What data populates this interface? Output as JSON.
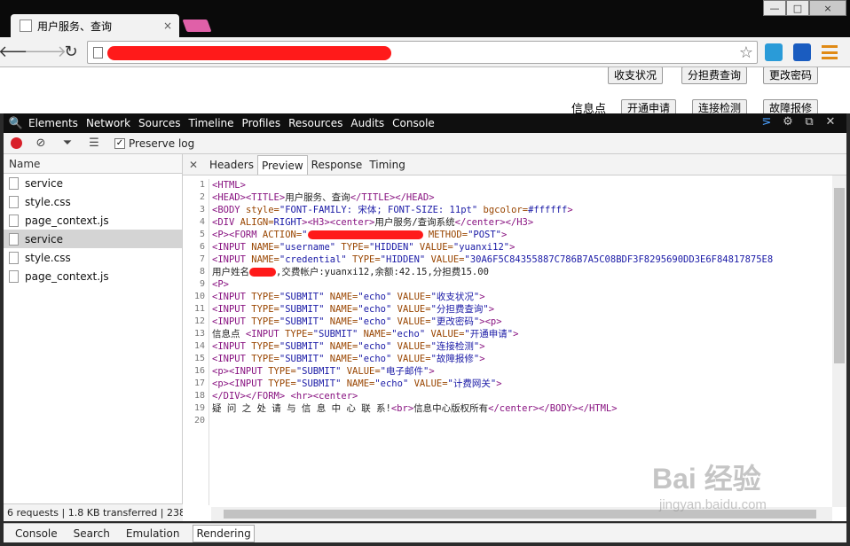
{
  "browser": {
    "tab_title": "用户服务、查询",
    "tab_close": "×",
    "win_min": "—",
    "win_max": "□",
    "win_close": "×"
  },
  "page": {
    "buttons": [
      "收支状况",
      "分担费查询",
      "更改密码",
      "开通申请",
      "连接检测",
      "故障报修"
    ],
    "info_label": "信息点"
  },
  "devtools": {
    "tabs": [
      "Elements",
      "Network",
      "Sources",
      "Timeline",
      "Profiles",
      "Resources",
      "Audits",
      "Console"
    ],
    "preserve_log": "Preserve log",
    "name_header": "Name",
    "requests": [
      {
        "name": "service",
        "selected": false
      },
      {
        "name": "style.css",
        "selected": false
      },
      {
        "name": "page_context.js",
        "selected": false
      },
      {
        "name": "service",
        "selected": true
      },
      {
        "name": "style.css",
        "selected": false
      },
      {
        "name": "page_context.js",
        "selected": false
      }
    ],
    "status_summary": "6 requests | 1.8 KB transferred | 238 ...",
    "subtabs": [
      "Headers",
      "Preview",
      "Response",
      "Timing"
    ],
    "active_subtab": "Preview",
    "drawer_tabs": [
      "Console",
      "Search",
      "Emulation",
      "Rendering"
    ],
    "active_drawer": "Rendering"
  },
  "code": {
    "line_numbers": [
      "1",
      "2",
      "3",
      "4",
      "5",
      "6",
      "7",
      "8",
      "9",
      "10",
      "11",
      "12",
      "13",
      "14",
      "15",
      "16",
      "17",
      "18",
      "19",
      "20"
    ],
    "l1_tag": "<HTML>",
    "l2_a": "<HEAD><TITLE>",
    "l2_b": "用户服务、查询",
    "l2_c": "</TITLE></HEAD>",
    "l3_a": "<BODY ",
    "l3_b": "style=",
    "l3_c": "\"FONT-FAMILY: 宋体; FONT-SIZE: 11pt\"",
    "l3_d": " bgcolor=",
    "l3_e": "#ffffff",
    "l3_f": ">",
    "l4_a": "<DIV ",
    "l4_b": "ALIGN=",
    "l4_c": "RIGHT",
    "l4_d": "><H3><center>",
    "l4_e": "用户服务/查询系统",
    "l4_f": "</center></H3>",
    "l5_a": "<P><FORM ",
    "l5_b": "ACTION=",
    "l5_c": "\"",
    "l5_d": " METHOD=",
    "l5_e": "\"POST\"",
    "l5_f": ">",
    "l6_a": "<INPUT ",
    "l6_b": "NAME=",
    "l6_c": "\"username\"",
    "l6_d": " TYPE=",
    "l6_e": "\"HIDDEN\"",
    "l6_f": " VALUE=",
    "l6_g": "\"yuanxi12\"",
    "l6_h": ">",
    "l7_a": "<INPUT ",
    "l7_b": "NAME=",
    "l7_c": "\"credential\"",
    "l7_d": " TYPE=",
    "l7_e": "\"HIDDEN\"",
    "l7_f": " VALUE=",
    "l7_g": "\"30A6F5C84355887C786B7A5C08BDF3F8295690DD3E6F84817875E8",
    "l8_a": "用户姓名",
    "l8_b": ",交费帐户:yuanxi12,余额:42.15,分担费15.00",
    "l9_a": "<P>",
    "l10_a": "<INPUT ",
    "l10_b": "TYPE=",
    "l10_c": "\"SUBMIT\"",
    "l10_d": " NAME=",
    "l10_e": "\"echo\"",
    "l10_f": " VALUE=",
    "l10_g": "\"收支状况\"",
    "l10_h": ">",
    "l11_a": "<INPUT ",
    "l11_b": "TYPE=",
    "l11_c": "\"SUBMIT\"",
    "l11_d": " NAME=",
    "l11_e": "\"echo\"",
    "l11_f": " VALUE=",
    "l11_g": "\"分担费查询\"",
    "l11_h": ">",
    "l12_a": "<INPUT ",
    "l12_b": "TYPE=",
    "l12_c": "\"SUBMIT\"",
    "l12_d": " NAME=",
    "l12_e": "\"echo\"",
    "l12_f": " VALUE=",
    "l12_g": "\"更改密码\"",
    "l12_h": "><p>",
    "l13_a": "信息点 ",
    "l13_b": "<INPUT ",
    "l13_c": "TYPE=",
    "l13_d": "\"SUBMIT\"",
    "l13_e": " NAME=",
    "l13_f": "\"echo\"",
    "l13_g": " VALUE=",
    "l13_h": "\"开通申请\"",
    "l13_i": ">",
    "l14_a": "<INPUT ",
    "l14_b": "TYPE=",
    "l14_c": "\"SUBMIT\"",
    "l14_d": " NAME=",
    "l14_e": "\"echo\"",
    "l14_f": " VALUE=",
    "l14_g": "\"连接检测\"",
    "l14_h": ">",
    "l15_a": "<INPUT ",
    "l15_b": "TYPE=",
    "l15_c": "\"SUBMIT\"",
    "l15_d": " NAME=",
    "l15_e": "\"echo\"",
    "l15_f": " VALUE=",
    "l15_g": "\"故障报修\"",
    "l15_h": ">",
    "l16_a": "<p><INPUT ",
    "l16_b": "TYPE=",
    "l16_c": "\"SUBMIT\"",
    "l16_d": " VALUE=",
    "l16_e": "\"电子邮件\"",
    "l16_f": ">",
    "l17_a": "<p><INPUT ",
    "l17_b": "TYPE=",
    "l17_c": "\"SUBMIT\"",
    "l17_d": " NAME=",
    "l17_e": "\"echo\"",
    "l17_f": " VALUE=",
    "l17_g": "\"计费网关\"",
    "l17_h": ">",
    "l18_a": "</DIV></FORM> <hr><center>",
    "l19_a": "疑 问 之 处 请 与 信 息 中 心 联 系!",
    "l19_b": "<br>",
    "l19_c": "信息中心版权所有",
    "l19_d": "</center></BODY></HTML>"
  },
  "watermark": {
    "main": "Bai 经验",
    "sub": "jingyan.baidu.com"
  }
}
